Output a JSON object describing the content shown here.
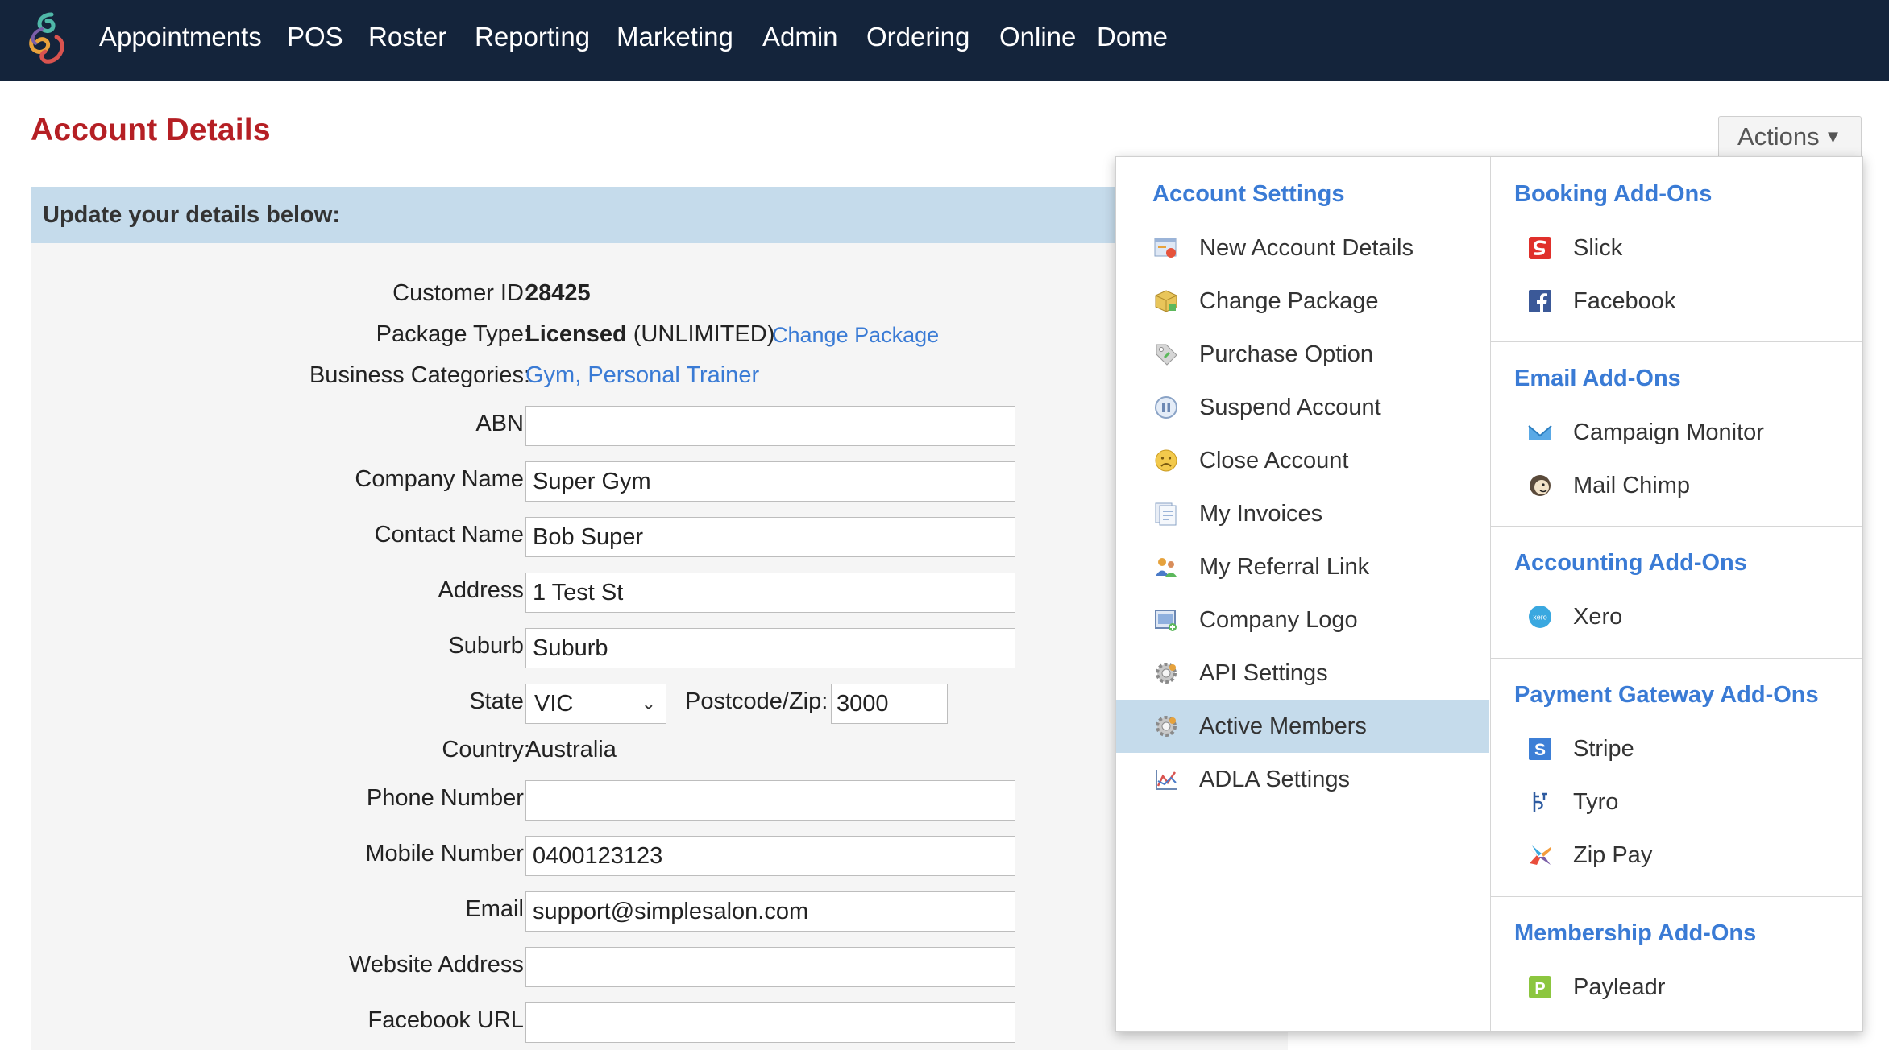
{
  "nav": {
    "items": [
      "Appointments",
      "POS",
      "Roster",
      "Reporting",
      "Marketing",
      "Admin",
      "Ordering",
      "Online",
      "Dome"
    ],
    "logo_icon": "swirl-logo-icon",
    "background": "#14243b"
  },
  "page": {
    "title": "Account Details",
    "title_color": "#b51f24",
    "actions_label": "Actions"
  },
  "form": {
    "header": "Update your details below:",
    "customer_id_label": "Customer ID:",
    "customer_id": "28425",
    "package_type_label": "Package Type:",
    "package_type_bold": "Licensed",
    "package_type_rest": " (UNLIMITED)",
    "change_package_link": "Change Package",
    "business_categories_label": "Business Categories:",
    "business_categories": "Gym, Personal Trainer",
    "abn_label": "ABN:",
    "abn": "",
    "company_name_label": "Company Name:",
    "company_name": "Super Gym",
    "contact_name_label": "Contact Name:",
    "contact_name": "Bob Super",
    "address_label": "Address:",
    "address": "1 Test St",
    "suburb_label": "Suburb:",
    "suburb": "Suburb",
    "state_label": "State:",
    "state": "VIC",
    "postcode_label": "Postcode/Zip:",
    "postcode": "3000",
    "country_label": "Country:",
    "country": "Australia",
    "phone_label": "Phone Number:",
    "phone": "",
    "mobile_label": "Mobile Number:",
    "mobile": "0400123123",
    "email_label": "Email:",
    "email": "support@simplesalon.com",
    "website_label": "Website Address:",
    "website": "",
    "facebook_label": "Facebook URL:",
    "facebook": ""
  },
  "menu": {
    "account_settings": {
      "heading": "Account Settings",
      "items": [
        {
          "label": "New Account Details",
          "icon": "account-details-icon"
        },
        {
          "label": "Change Package",
          "icon": "package-icon"
        },
        {
          "label": "Purchase Option",
          "icon": "tag-icon"
        },
        {
          "label": "Suspend Account",
          "icon": "pause-icon"
        },
        {
          "label": "Close Account",
          "icon": "sad-face-icon"
        },
        {
          "label": "My Invoices",
          "icon": "invoices-icon"
        },
        {
          "label": "My Referral Link",
          "icon": "referral-icon"
        },
        {
          "label": "Company Logo",
          "icon": "logo-image-icon"
        },
        {
          "label": "API Settings",
          "icon": "gear-icon"
        },
        {
          "label": "Active Members",
          "icon": "gear-icon",
          "active": true
        },
        {
          "label": "ADLA Settings",
          "icon": "chart-icon"
        }
      ]
    },
    "booking": {
      "heading": "Booking Add-Ons",
      "items": [
        {
          "label": "Slick",
          "icon": "slick-icon"
        },
        {
          "label": "Facebook",
          "icon": "facebook-icon"
        }
      ]
    },
    "email": {
      "heading": "Email Add-Ons",
      "items": [
        {
          "label": "Campaign Monitor",
          "icon": "campaign-monitor-icon"
        },
        {
          "label": "Mail Chimp",
          "icon": "mailchimp-icon"
        }
      ]
    },
    "accounting": {
      "heading": "Accounting Add-Ons",
      "items": [
        {
          "label": "Xero",
          "icon": "xero-icon"
        }
      ]
    },
    "payment": {
      "heading": "Payment Gateway Add-Ons",
      "items": [
        {
          "label": "Stripe",
          "icon": "stripe-icon"
        },
        {
          "label": "Tyro",
          "icon": "tyro-icon"
        },
        {
          "label": "Zip Pay",
          "icon": "zip-pay-icon"
        }
      ]
    },
    "membership": {
      "heading": "Membership Add-Ons",
      "items": [
        {
          "label": "Payleadr",
          "icon": "payleadr-icon"
        }
      ]
    }
  },
  "colors": {
    "link": "#3a7bd5",
    "header_band": "#c5dbeb",
    "active_item": "#c5dbeb"
  }
}
